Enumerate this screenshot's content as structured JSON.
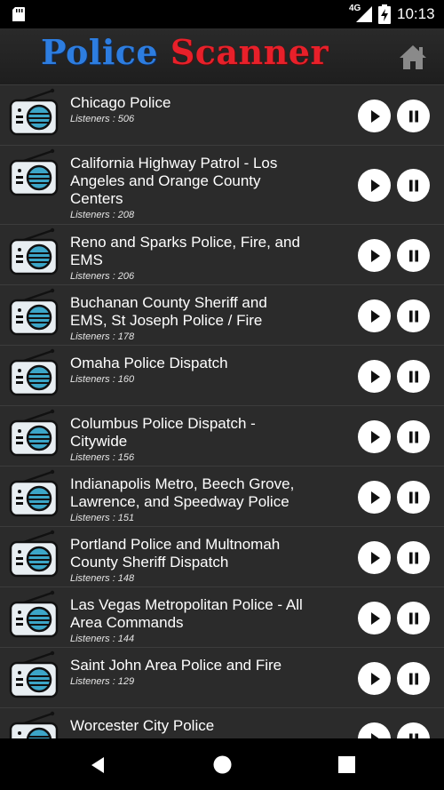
{
  "status_bar": {
    "network": "4G",
    "time": "10:13",
    "icons": [
      "sd-card-icon",
      "signal-icon",
      "battery-charging-icon"
    ]
  },
  "app_bar": {
    "title_part1": "Police",
    "title_part2": "Scanner",
    "title_colors": {
      "part1": "#2d7de0",
      "part2": "#e8202a"
    },
    "home_icon": "home-icon"
  },
  "stations": [
    {
      "name": "Chicago Police",
      "listeners": "Listeners : 506"
    },
    {
      "name": "California Highway Patrol - Los Angeles and Orange County Centers",
      "listeners": "Listeners : 208"
    },
    {
      "name": "Reno and Sparks Police, Fire, and EMS",
      "listeners": "Listeners : 206"
    },
    {
      "name": "Buchanan County Sheriff and EMS, St Joseph Police / Fire",
      "listeners": "Listeners : 178"
    },
    {
      "name": "Omaha Police Dispatch",
      "listeners": "Listeners : 160"
    },
    {
      "name": "Columbus Police Dispatch - Citywide",
      "listeners": "Listeners : 156"
    },
    {
      "name": "Indianapolis Metro, Beech Grove, Lawrence, and Speedway Police",
      "listeners": "Listeners : 151"
    },
    {
      "name": "Portland Police and Multnomah County Sheriff Dispatch",
      "listeners": "Listeners : 148"
    },
    {
      "name": "Las Vegas Metropolitan Police - All Area Commands",
      "listeners": "Listeners : 144"
    },
    {
      "name": "Saint John Area Police and Fire",
      "listeners": "Listeners : 129"
    },
    {
      "name": "Worcester City Police",
      "listeners": ""
    }
  ],
  "nav_bar": {
    "icons": [
      "back-icon",
      "home-nav-icon",
      "recents-icon"
    ]
  }
}
